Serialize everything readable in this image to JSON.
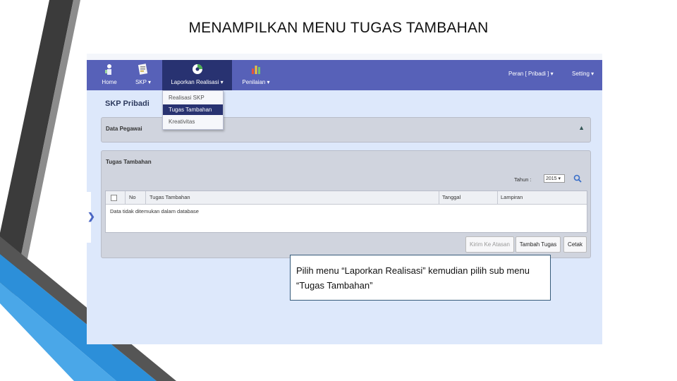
{
  "slide": {
    "title": "MENAMPILKAN MENU TUGAS TAMBAHAN"
  },
  "colors": {
    "navbar": "#5761b8",
    "nav_active": "#283271",
    "page_bg": "#dde8fb",
    "panel_bg": "#d0d4de",
    "deco_dark": "#3b3b3b",
    "deco_blue": "#2c8fd9"
  },
  "navbar": {
    "items": [
      {
        "label": "Home",
        "icon": "home-icon"
      },
      {
        "label": "SKP ▾",
        "icon": "document-icon"
      },
      {
        "label": "Laporkan Realisasi ▾",
        "icon": "report-chart-icon"
      },
      {
        "label": "Penilaian ▾",
        "icon": "bar-chart-icon"
      }
    ],
    "peran_label": "Peran [ Pribadi ] ▾",
    "setting_label": "Setting ▾"
  },
  "dropdown": {
    "items": [
      "Realisasi SKP",
      "Tugas Tambahan",
      "Kreativitas"
    ],
    "active_index": 1
  },
  "page": {
    "heading": "SKP Pribadi"
  },
  "data_pegawai": {
    "title": "Data Pegawai",
    "collapse_icon": "chevron-up-icon"
  },
  "tugas_tambahan": {
    "title": "Tugas Tambahan",
    "tahun_label": "Tahun :",
    "tahun_value": "2015 ▾",
    "search_icon": "search-icon",
    "columns": [
      "No",
      "Tugas Tambahan",
      "Tanggal",
      "Lampiran"
    ],
    "empty_message": "Data tidak ditemukan dalam database",
    "buttons": [
      "Kirim Ke Atasan",
      "Tambah Tugas",
      "Cetak"
    ]
  },
  "sidebar_toggle": {
    "icon": "chevron-right-icon"
  },
  "callout": {
    "text": "Pilih menu “Laporkan Realisasi” kemudian pilih sub menu “Tugas Tambahan”"
  }
}
